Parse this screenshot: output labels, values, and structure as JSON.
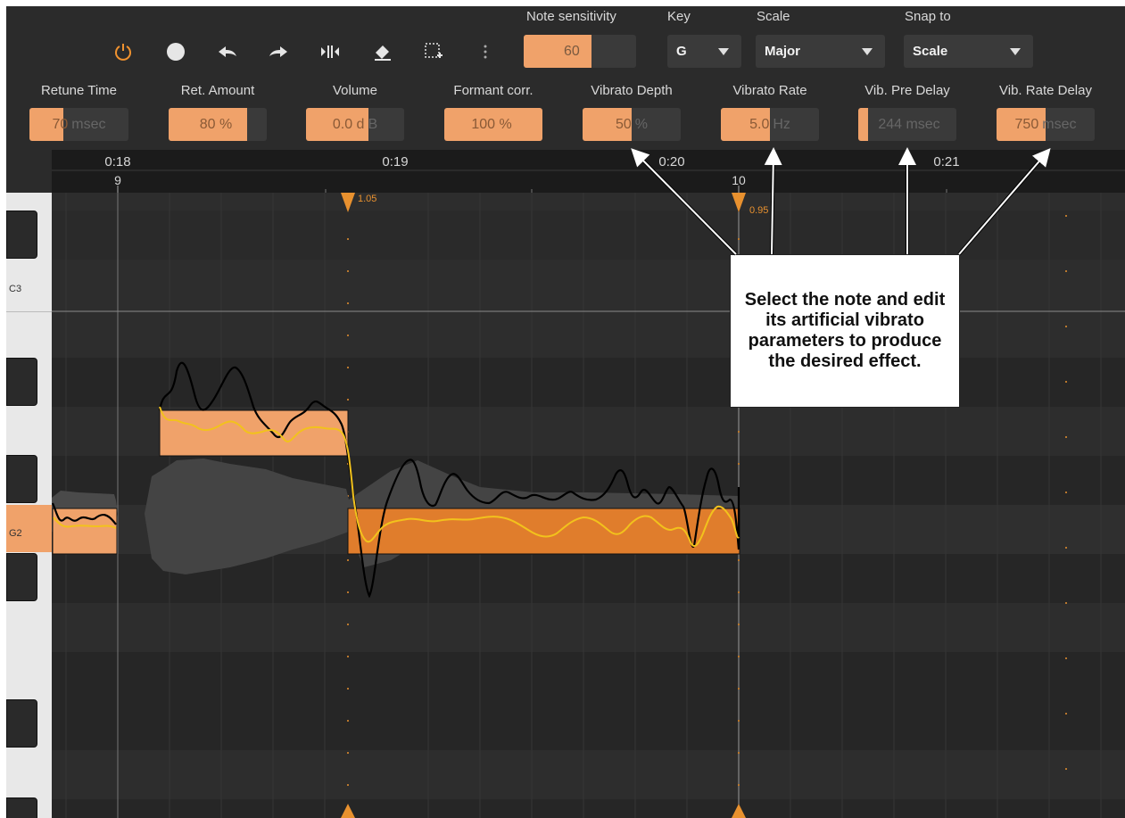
{
  "toolbar": {
    "icons": [
      "power-icon",
      "record-icon",
      "undo-icon",
      "redo-icon",
      "split-icon",
      "eraser-icon",
      "select-add-icon",
      "more-icon"
    ],
    "note_sensitivity": {
      "label": "Note sensitivity",
      "value": "60",
      "fill": 0.56
    },
    "key": {
      "label": "Key",
      "value": "G"
    },
    "scale": {
      "label": "Scale",
      "value": "Major"
    },
    "snap": {
      "label": "Snap to",
      "value": "Scale"
    }
  },
  "params": [
    {
      "label": "Retune Time",
      "value": "70",
      "unit": "msec",
      "fill": 0.34
    },
    {
      "label": "Ret. Amount",
      "value": "80 %",
      "unit": "",
      "fill": 0.8
    },
    {
      "label": "Volume",
      "value": "0.0 d",
      "unit": "B",
      "fill": 0.64
    },
    {
      "label": "Formant corr.",
      "value": "100 %",
      "unit": "",
      "fill": 1.0
    },
    {
      "label": "Vibrato Depth",
      "value": "50",
      "unit": "%",
      "fill": 0.5
    },
    {
      "label": "Vibrato Rate",
      "value": "5.0",
      "unit": "Hz",
      "fill": 0.5
    },
    {
      "label": "Vib. Pre Delay",
      "value": "",
      "unit": "244 msec",
      "fill": 0.1
    },
    {
      "label": "Vib. Rate Delay",
      "value": "750",
      "unit": "msec",
      "fill": 0.5
    }
  ],
  "timeline": {
    "times": [
      "0:18",
      "0:19",
      "0:20",
      "0:21"
    ],
    "bars": [
      "9",
      "10"
    ]
  },
  "markers": [
    "1.05",
    "0.95"
  ],
  "keys": {
    "c3": "C3",
    "g2": "G2"
  },
  "callout": "Select the note and edit its artificial vibrato parameters to produce the desired effect.",
  "colors": {
    "accent": "#f0a26a",
    "note_selected": "#e07d2c",
    "pitch_line": "#f2c21c",
    "background": "#2b2b2b"
  }
}
